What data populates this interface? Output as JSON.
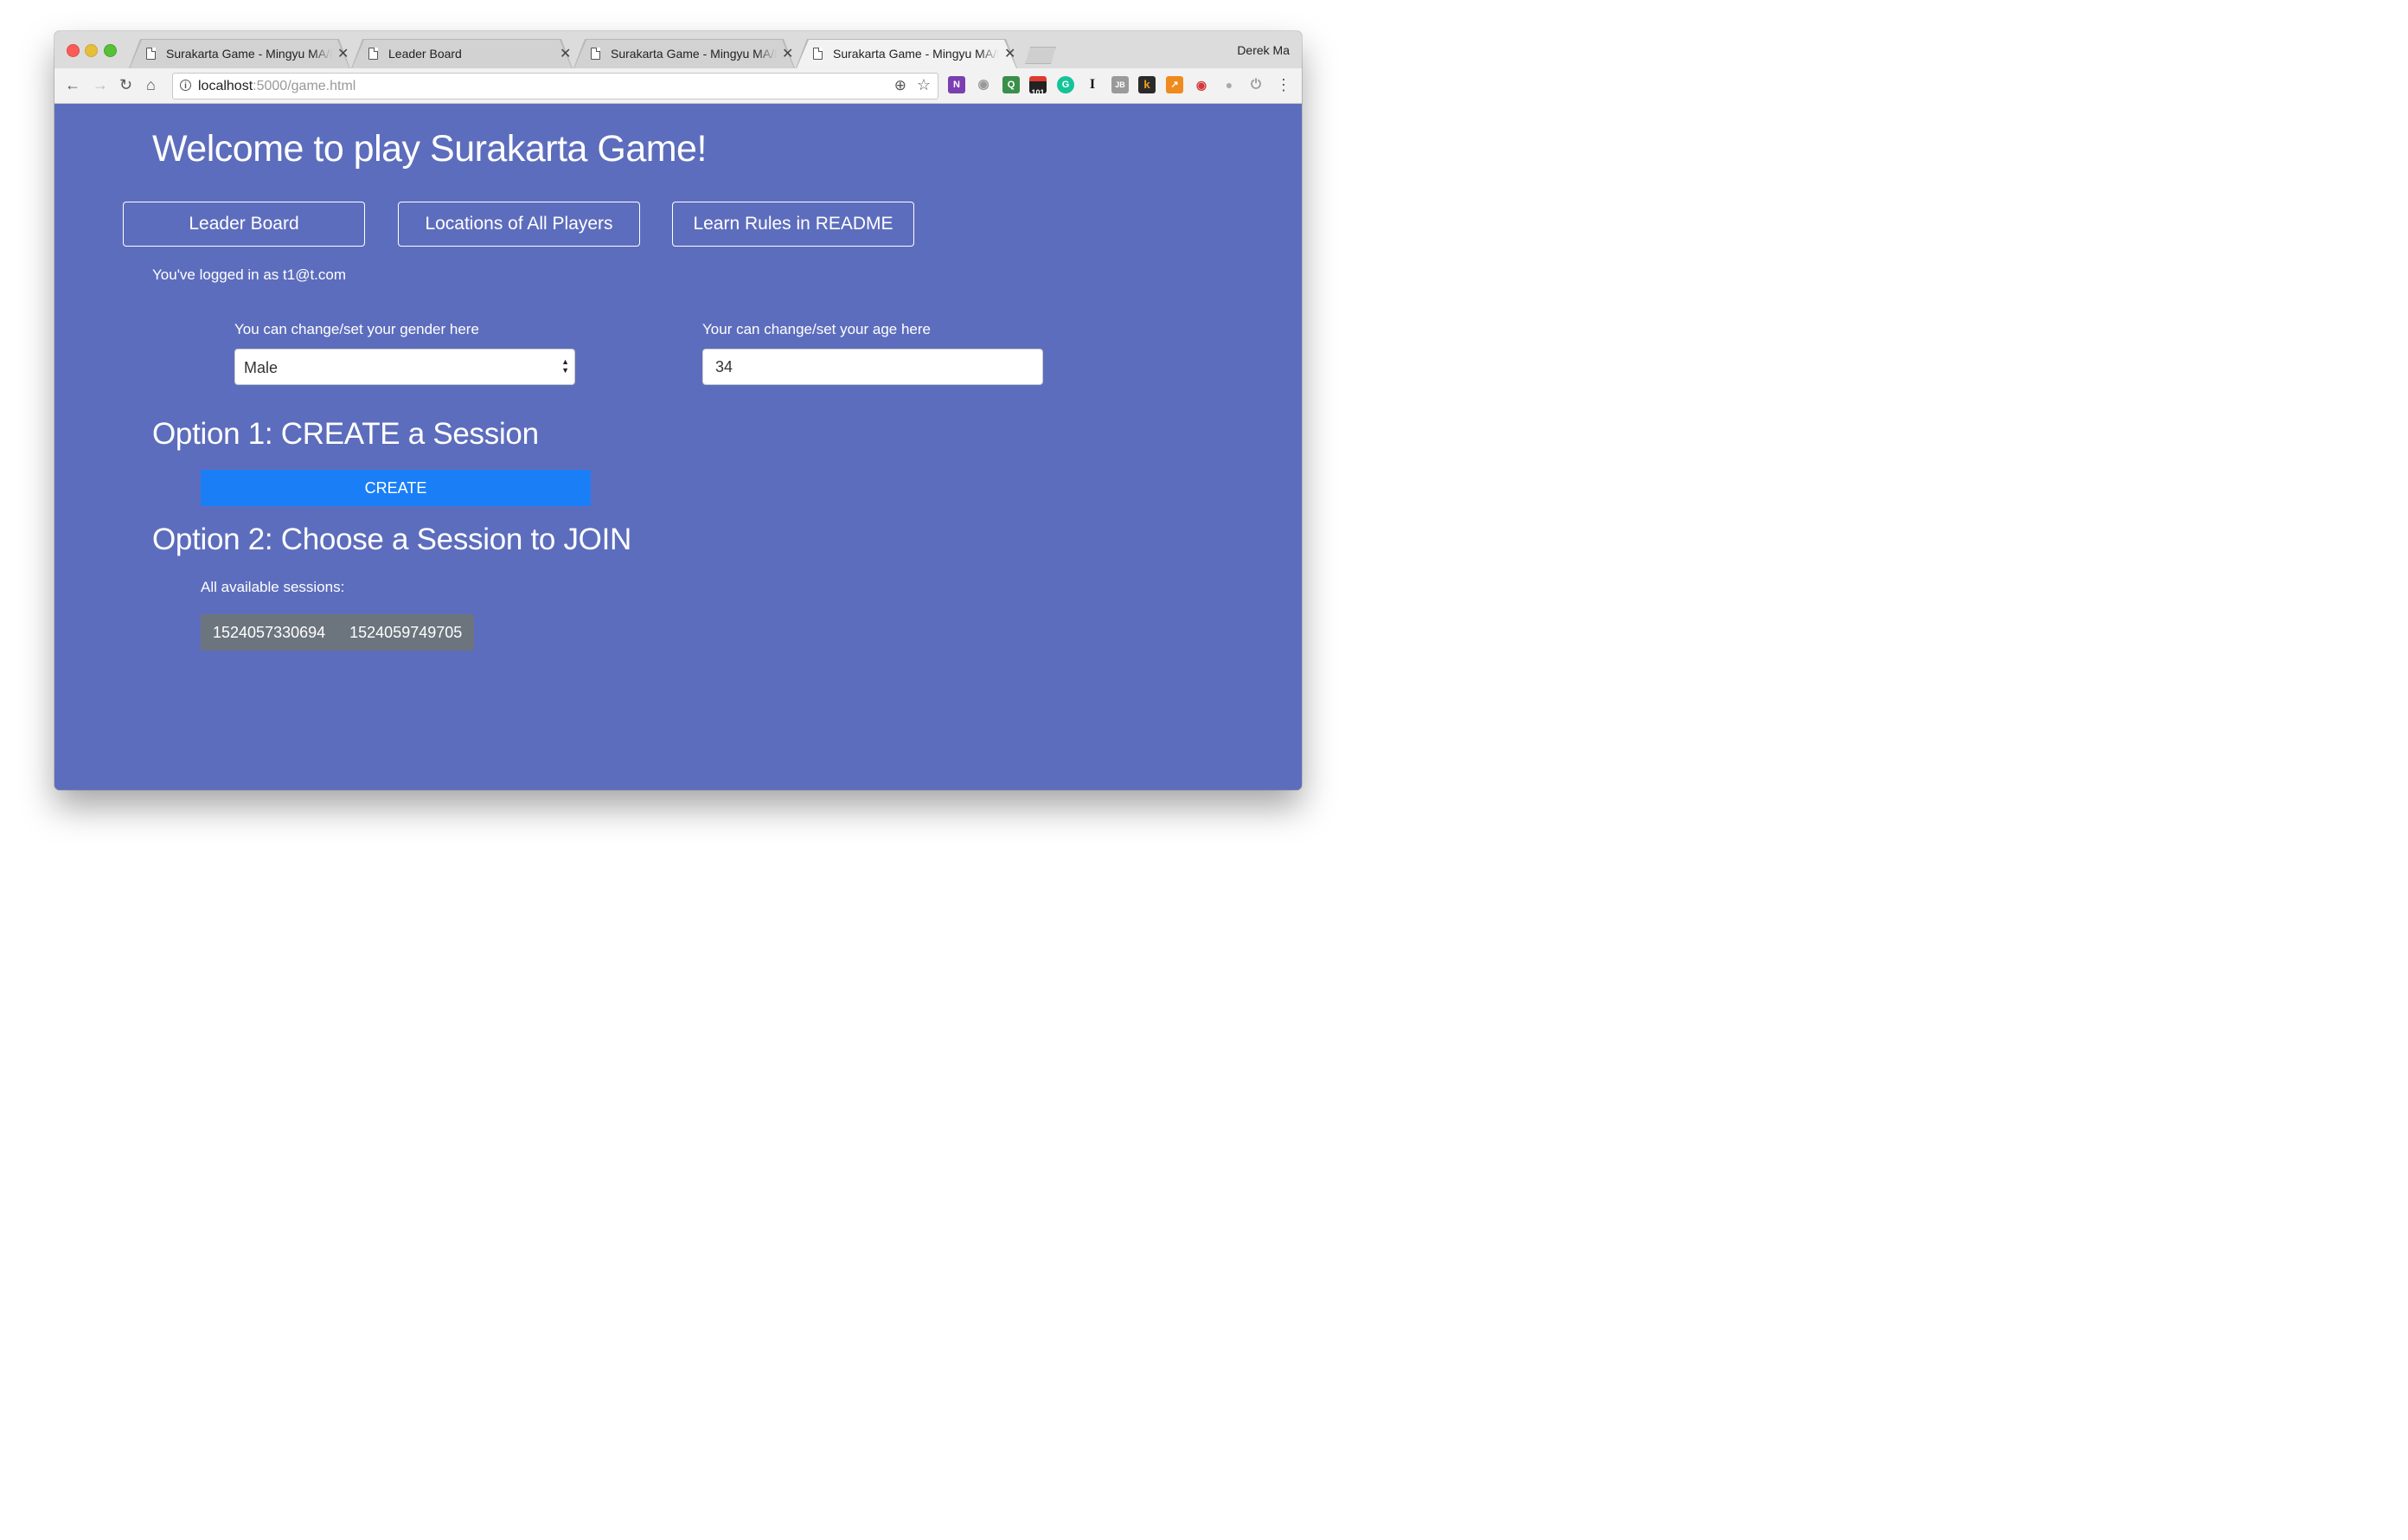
{
  "browser": {
    "tabs": [
      {
        "title": "Surakarta Game - Mingyu MA/Derek Ma",
        "active": false
      },
      {
        "title": "Leader Board",
        "active": false
      },
      {
        "title": "Surakarta Game - Mingyu MA/Derek Ma",
        "active": false
      },
      {
        "title": "Surakarta Game - Mingyu MA/Derek Ma",
        "active": true
      }
    ],
    "profile_name": "Derek Ma",
    "url_host": "localhost",
    "url_rest": ":5000/game.html",
    "close_glyph": "✕",
    "extension_icons": [
      "onenote-icon",
      "camera-icon",
      "screenshot-icon",
      "counter-101-icon",
      "grammarly-icon",
      "instapaper-icon",
      "jetbrains-icon",
      "keepa-icon",
      "chart-icon",
      "pocket-icon",
      "puppet-icon",
      "power-icon"
    ],
    "counter_badge": "101"
  },
  "page": {
    "heading": "Welcome to play Surakarta Game!",
    "nav_buttons": [
      "Leader Board",
      "Locations of All Players",
      "Learn Rules in README"
    ],
    "logged_in_text": "You've logged in as t1@t.com",
    "gender_label": "You can change/set your gender here",
    "gender_value": "Male",
    "age_label": "Your can change/set your age here",
    "age_value": "34",
    "option1_heading": "Option 1: CREATE a Session",
    "create_button": "CREATE",
    "option2_heading": "Option 2: Choose a Session to JOIN",
    "sessions_label": "All available sessions:",
    "sessions": [
      "1524057330694",
      "1524059749705"
    ]
  },
  "colors": {
    "page_background": "#5d6dbd",
    "create_button": "#1a7ff6",
    "sessions_background": "#6c757d"
  }
}
